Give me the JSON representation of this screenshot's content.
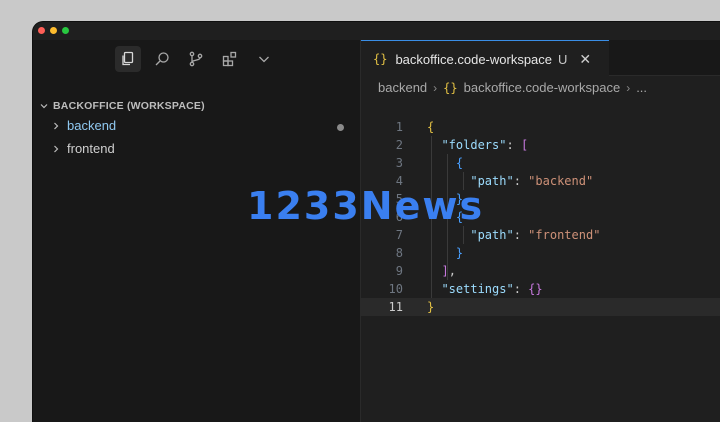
{
  "sidebar": {
    "workspace_header": "BACKOFFICE (WORKSPACE)",
    "items": [
      {
        "label": "backend"
      },
      {
        "label": "frontend"
      }
    ]
  },
  "tab": {
    "title": "backoffice.code-workspace",
    "modified": "U",
    "close": "✕",
    "icon": "{}"
  },
  "breadcrumb": {
    "folder": "backend",
    "file": "backoffice.code-workspace",
    "more": "..."
  },
  "code_lines": [
    {
      "n": "1"
    },
    {
      "n": "2"
    },
    {
      "n": "3"
    },
    {
      "n": "4"
    },
    {
      "n": "5"
    },
    {
      "n": "6"
    },
    {
      "n": "7"
    },
    {
      "n": "8"
    },
    {
      "n": "9"
    },
    {
      "n": "10"
    },
    {
      "n": "11"
    }
  ],
  "code": {
    "folders_key": "\"folders\"",
    "path_key": "\"path\"",
    "backend_val": "\"backend\"",
    "frontend_val": "\"frontend\"",
    "settings_key": "\"settings\""
  },
  "watermark": "1233News"
}
